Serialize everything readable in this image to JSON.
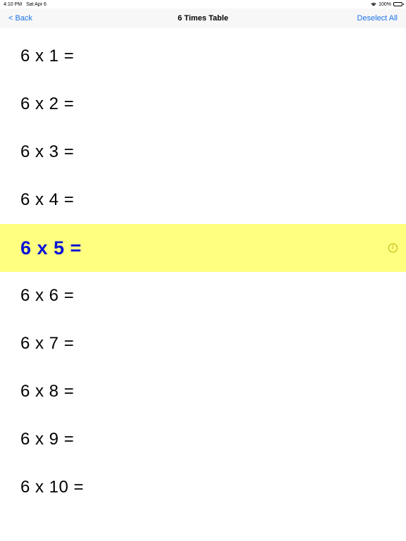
{
  "status_bar": {
    "time": "4:10 PM",
    "date": "Sat Apr 6",
    "battery": "100%",
    "wifi_icon": "wifi-icon",
    "battery_icon": "battery-icon"
  },
  "nav": {
    "back_label": "< Back",
    "title": "6 Times Table",
    "right_label": "Deselect All"
  },
  "rows": [
    {
      "label": "6 x 1 =",
      "selected": false
    },
    {
      "label": "6 x 2 =",
      "selected": false
    },
    {
      "label": "6 x 3 =",
      "selected": false
    },
    {
      "label": "6 x 4 =",
      "selected": false
    },
    {
      "label": "6 x 5 =",
      "selected": true,
      "info_icon": "i"
    },
    {
      "label": "6 x 6 =",
      "selected": false
    },
    {
      "label": "6 x 7 =",
      "selected": false
    },
    {
      "label": "6 x 8 =",
      "selected": false
    },
    {
      "label": "6 x 9 =",
      "selected": false
    },
    {
      "label": "6 x 10 =",
      "selected": false
    }
  ],
  "colors": {
    "accent": "#1a73e8",
    "selected_background": "#ffff80",
    "selected_text": "#0a14d6",
    "info_icon": "#b8b000"
  }
}
